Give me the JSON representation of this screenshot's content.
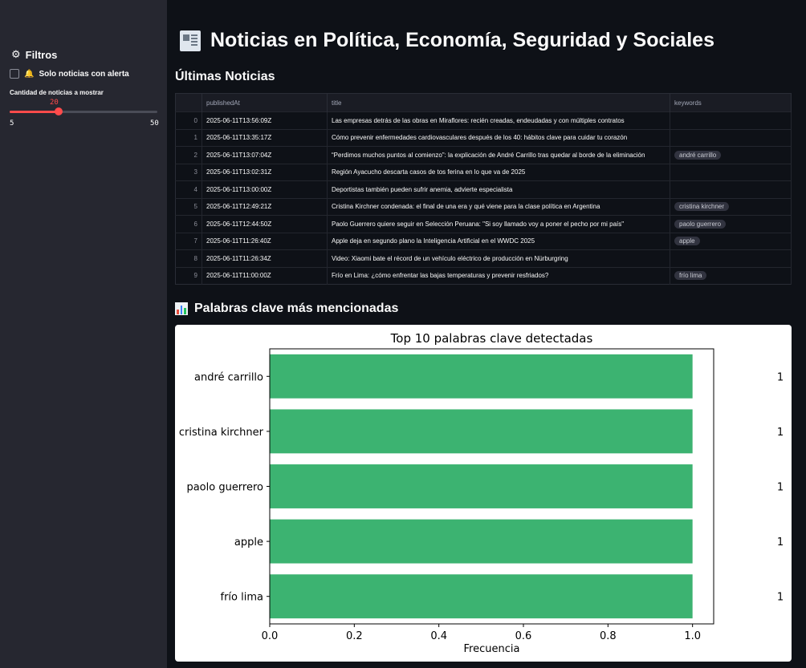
{
  "sidebar": {
    "header": "Filtros",
    "gear_icon": "gear-icon",
    "alert_checkbox_label": "Solo noticias con alerta",
    "alert_checked": false,
    "bell_icon": "bell-icon",
    "slider_label": "Cantidad de noticias a mostrar",
    "slider_value": "20",
    "slider_min": "5",
    "slider_max": "50",
    "slider_fraction": 0.3333,
    "accent_color": "#ff4b4b"
  },
  "header": {
    "title": "Noticias en Política, Economía, Seguridad y Sociales",
    "icon": "newspaper-icon"
  },
  "news_section": {
    "title": "Últimas Noticias",
    "columns": [
      "",
      "publishedAt",
      "title",
      "keywords"
    ],
    "rows": [
      {
        "index": "0",
        "publishedAt": "2025-06-11T13:56:09Z",
        "title": "Las empresas detrás de las obras en Miraflores: recién creadas, endeudadas y con múltiples contratos",
        "keywords": ""
      },
      {
        "index": "1",
        "publishedAt": "2025-06-11T13:35:17Z",
        "title": "Cómo prevenir enfermedades cardiovasculares después de los 40: hábitos clave para cuidar tu corazón",
        "keywords": ""
      },
      {
        "index": "2",
        "publishedAt": "2025-06-11T13:07:04Z",
        "title": "“Perdimos muchos puntos al comienzo”: la explicación de André Carrillo tras quedar al borde de la eliminación",
        "keywords": "andré carrillo"
      },
      {
        "index": "3",
        "publishedAt": "2025-06-11T13:02:31Z",
        "title": "Región Ayacucho descarta casos de tos ferina en lo que va de 2025",
        "keywords": ""
      },
      {
        "index": "4",
        "publishedAt": "2025-06-11T13:00:00Z",
        "title": "Deportistas también pueden sufrir anemia, advierte especialista",
        "keywords": ""
      },
      {
        "index": "5",
        "publishedAt": "2025-06-11T12:49:21Z",
        "title": "Cristina Kirchner condenada: el final de una era y qué viene para la clase política en Argentina",
        "keywords": "cristina kirchner"
      },
      {
        "index": "6",
        "publishedAt": "2025-06-11T12:44:50Z",
        "title": "Paolo Guerrero quiere seguir en Selección Peruana: \"Si soy llamado voy a poner el pecho por mi país\"",
        "keywords": "paolo guerrero"
      },
      {
        "index": "7",
        "publishedAt": "2025-06-11T11:26:40Z",
        "title": "Apple deja en segundo plano la Inteligencia Artificial en el WWDC 2025",
        "keywords": "apple"
      },
      {
        "index": "8",
        "publishedAt": "2025-06-11T11:26:34Z",
        "title": "Video: Xiaomi bate el récord de un vehículo eléctrico de producción en Nürburgring",
        "keywords": ""
      },
      {
        "index": "9",
        "publishedAt": "2025-06-11T11:00:00Z",
        "title": "Frío en Lima: ¿cómo enfrentar las bajas temperaturas y prevenir resfriados?",
        "keywords": "frío lima"
      }
    ]
  },
  "chart_section": {
    "title": "Palabras clave más mencionadas",
    "icon": "bar-chart-icon"
  },
  "chart_data": {
    "type": "bar",
    "orientation": "horizontal",
    "title": "Top 10 palabras clave detectadas",
    "xlabel": "Frecuencia",
    "ylabel": "",
    "categories": [
      "andré carrillo",
      "cristina kirchner",
      "paolo guerrero",
      "apple",
      "frío lima"
    ],
    "values": [
      1,
      1,
      1,
      1,
      1
    ],
    "value_labels": [
      "1",
      "1",
      "1",
      "1",
      "1"
    ],
    "xlim": [
      0,
      1.05
    ],
    "xticks": [
      "0.0",
      "0.2",
      "0.4",
      "0.6",
      "0.8",
      "1.0"
    ],
    "bar_color": "#3cb371",
    "grid": false
  }
}
